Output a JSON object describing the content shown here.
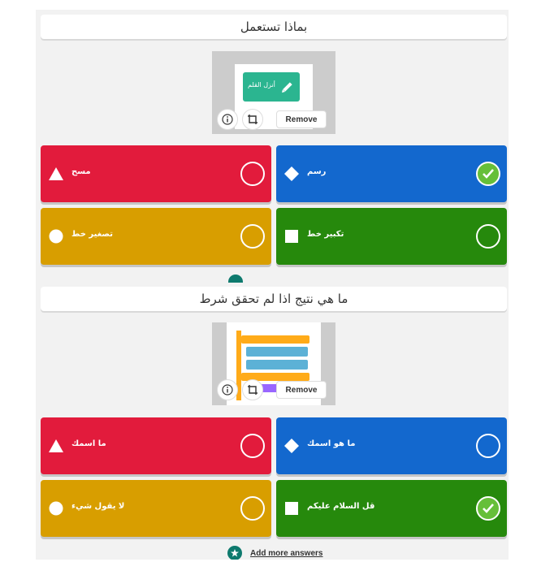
{
  "questions": [
    {
      "title": "بماذا تستعمل",
      "image_block_text": "أنزل القلم",
      "media": {
        "info_icon": "info-icon",
        "crop_icon": "crop-icon",
        "remove_label": "Remove"
      },
      "answers": [
        {
          "text": "مسح",
          "color": "#e21b3c",
          "shape": "triangle",
          "correct": false
        },
        {
          "text": "رسم",
          "color": "#1368ce",
          "shape": "diamond",
          "correct": true
        },
        {
          "text": "تصغير خط",
          "color": "#d89e00",
          "shape": "circle",
          "correct": false
        },
        {
          "text": "تكبير خط",
          "color": "#26890c",
          "shape": "square",
          "correct": false
        }
      ]
    },
    {
      "title": "ما هي نتيج  اذا لم تحقق شرط",
      "media": {
        "info_icon": "info-icon",
        "crop_icon": "crop-icon",
        "remove_label": "Remove"
      },
      "answers": [
        {
          "text": "ما اسمك",
          "color": "#e21b3c",
          "shape": "triangle",
          "correct": false
        },
        {
          "text": "ما  هو اسمك",
          "color": "#1368ce",
          "shape": "diamond",
          "correct": false
        },
        {
          "text": "لا يقول شيء",
          "color": "#d89e00",
          "shape": "circle",
          "correct": false
        },
        {
          "text": "قل السلام عليكم",
          "color": "#26890c",
          "shape": "square",
          "correct": true
        }
      ]
    }
  ],
  "add_more": {
    "label": "Add more answers",
    "icon": "star-icon"
  }
}
